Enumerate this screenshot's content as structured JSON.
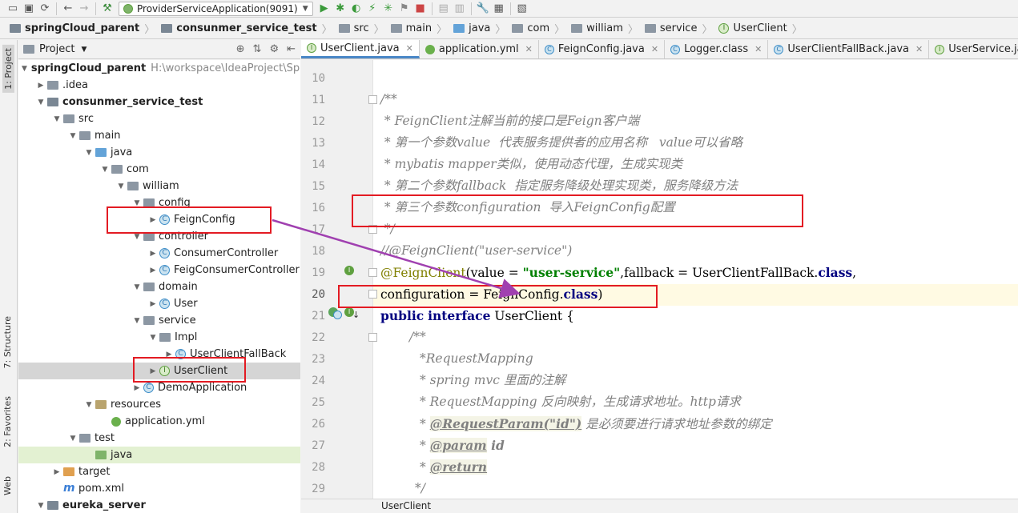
{
  "toolbar": {
    "run_config": "ProviderServiceApplication(9091)"
  },
  "breadcrumb": [
    {
      "label": "springCloud_parent"
    },
    {
      "label": "consunmer_service_test"
    },
    {
      "label": "src"
    },
    {
      "label": "main"
    },
    {
      "label": "java"
    },
    {
      "label": "com"
    },
    {
      "label": "william"
    },
    {
      "label": "service"
    },
    {
      "label": "UserClient"
    }
  ],
  "left_strip": {
    "project": "1: Project",
    "structure": "7: Structure",
    "favorites": "2: Favorites",
    "web": "Web"
  },
  "panel": {
    "title": "Project"
  },
  "tree": [
    {
      "label": "springCloud_parent",
      "suffix": "H:\\workspace\\IdeaProject\\Sprin"
    },
    {
      "label": ".idea"
    },
    {
      "label": "consunmer_service_test"
    },
    {
      "label": "src"
    },
    {
      "label": "main"
    },
    {
      "label": "java"
    },
    {
      "label": "com"
    },
    {
      "label": "william"
    },
    {
      "label": "config"
    },
    {
      "label": "FeignConfig"
    },
    {
      "label": "controller"
    },
    {
      "label": "ConsumerController"
    },
    {
      "label": "FeigConsumerController"
    },
    {
      "label": "domain"
    },
    {
      "label": "User"
    },
    {
      "label": "service"
    },
    {
      "label": "Impl"
    },
    {
      "label": "UserClientFallBack"
    },
    {
      "label": "UserClient"
    },
    {
      "label": "DemoApplication"
    },
    {
      "label": "resources"
    },
    {
      "label": "application.yml"
    },
    {
      "label": "test"
    },
    {
      "label": "java"
    },
    {
      "label": "target"
    },
    {
      "label": "pom.xml"
    },
    {
      "label": "eureka_server"
    }
  ],
  "tabs": [
    {
      "label": "UserClient.java"
    },
    {
      "label": "application.yml"
    },
    {
      "label": "FeignConfig.java"
    },
    {
      "label": "Logger.class"
    },
    {
      "label": "UserClientFallBack.java"
    },
    {
      "label": "UserService.java"
    }
  ],
  "editor": {
    "line_numbers": [
      "10",
      "11",
      "12",
      "13",
      "14",
      "15",
      "16",
      "17",
      "18",
      "19",
      "20",
      "21",
      "22",
      "23",
      "24",
      "25",
      "26",
      "27",
      "28",
      "29"
    ],
    "code": {
      "l11": "/**",
      "l12": " * FeignClient注解当前的接口是Feign客户端",
      "l13": " * 第一个参数value  代表服务提供者的应用名称   value可以省略",
      "l14": " * mybatis mapper类似，使用动态代理，生成实现类",
      "l15": " * 第二个参数fallback  指定服务降级处理实现类，服务降级方法",
      "l16": " * 第三个参数configuration  导入FeignConfig配置",
      "l17": " */",
      "l18": "//@FeignClient(\"user-service\")",
      "l19_ann": "@FeignClient",
      "l19_a": "(value = ",
      "l19_str": "\"user-service\"",
      "l19_b": ",fallback = UserClientFallBack.",
      "l19_kw": "class",
      "l19_c": ",",
      "l20_a": "configuration = FeignConfig.",
      "l20_kw": "class",
      "l20_b": ")",
      "l21_kw1": "public",
      "l21_kw2": "interface",
      "l21_rest": " UserClient {",
      "l22": "/**",
      "l23": "*RequestMapping",
      "l24": "* spring mvc 里面的注解",
      "l25": "* RequestMapping 反向映射，生成请求地址。http请求",
      "l26_tag": "@RequestParam(\"id\")",
      "l26_rest": " 是必须要进行请求地址参数的绑定",
      "l27_tag": "@param",
      "l27_rest": " id",
      "l28_tag": "@return",
      "l29": "*/"
    }
  },
  "status": {
    "context": "UserClient"
  },
  "colors": {
    "highlight_box": "#e31b23",
    "arrow": "#a040b0",
    "current_line": "#fffae3"
  }
}
